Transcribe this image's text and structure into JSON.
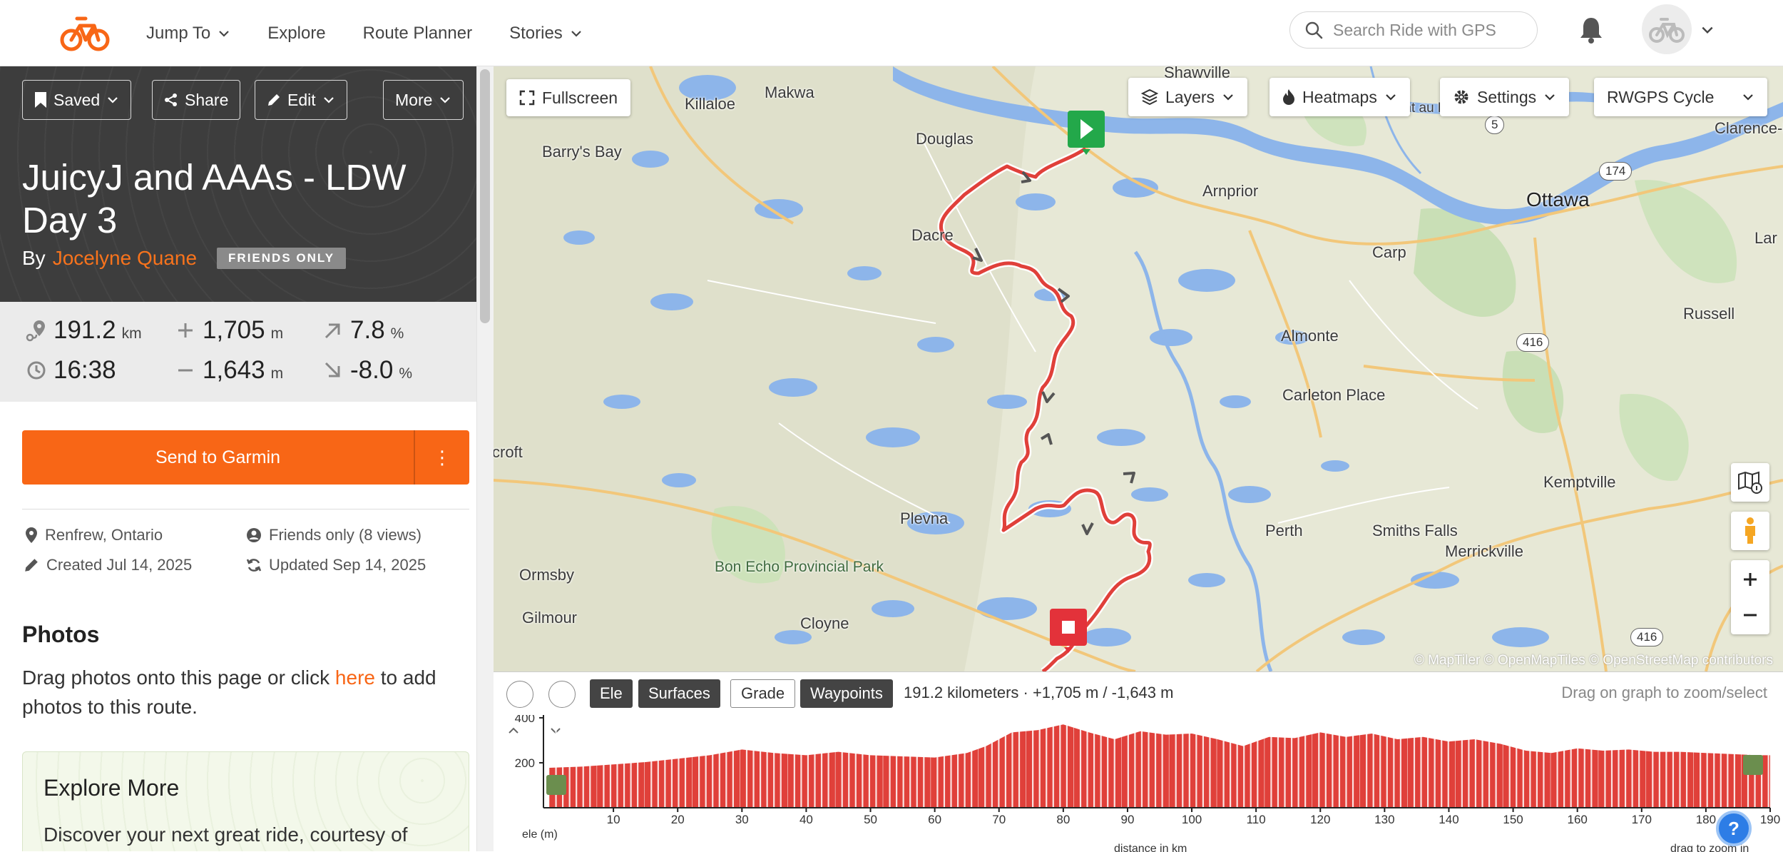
{
  "nav": {
    "items": [
      {
        "label": "Jump To",
        "has_dropdown": true
      },
      {
        "label": "Explore",
        "has_dropdown": false
      },
      {
        "label": "Route Planner",
        "has_dropdown": false
      },
      {
        "label": "Stories",
        "has_dropdown": true
      }
    ],
    "search_placeholder": "Search Ride with GPS",
    "icons": {
      "logo": "bike-logo",
      "search": "search-icon",
      "bell": "bell-icon",
      "avatar": "bike-avatar-icon"
    }
  },
  "route": {
    "buttons": {
      "saved": "Saved",
      "share": "Share",
      "edit": "Edit",
      "more": "More"
    },
    "title": "JuicyJ and AAAs - LDW Day 3",
    "by_prefix": "By",
    "author": "Jocelyne Quane",
    "visibility_badge": "FRIENDS ONLY",
    "stats": {
      "distance": {
        "value": "191.2",
        "unit": "km"
      },
      "elevation_gain": {
        "value": "1,705",
        "unit": "m"
      },
      "max_grade": {
        "value": "7.8",
        "unit": "%"
      },
      "duration": {
        "value": "16:38",
        "unit": ""
      },
      "elevation_loss": {
        "value": "1,643",
        "unit": "m"
      },
      "min_grade": {
        "value": "-8.0",
        "unit": "%"
      }
    },
    "send_button": "Send to Garmin",
    "send_more": "⋮",
    "meta": {
      "location": "Renfrew, Ontario",
      "views": "Friends only (8 views)",
      "created": "Created Jul 14, 2025",
      "updated": "Updated Sep 14, 2025"
    },
    "photos": {
      "heading": "Photos",
      "text_before": "Drag photos onto this page or click ",
      "link": "here",
      "text_after": " to add photos to this route."
    },
    "explore": {
      "heading": "Explore More",
      "text": "Discover your next great ride, courtesy of"
    }
  },
  "map": {
    "controls": {
      "fullscreen": "Fullscreen",
      "layers": "Layers",
      "heatmaps": "Heatmaps",
      "settings": "Settings",
      "style": "RWGPS Cycle"
    },
    "places": [
      {
        "name": "Shawville"
      },
      {
        "name": "Killaloe"
      },
      {
        "name": "Makwa"
      },
      {
        "name": "Barry's Bay"
      },
      {
        "name": "Douglas"
      },
      {
        "name": "Mont au McKinstry"
      },
      {
        "name": "Clarence-R"
      },
      {
        "name": "Ottawa"
      },
      {
        "name": "Arnprior"
      },
      {
        "name": "Dacre"
      },
      {
        "name": "Carp"
      },
      {
        "name": "Lar"
      },
      {
        "name": "Russell"
      },
      {
        "name": "Almonte"
      },
      {
        "name": "Carleton Place"
      },
      {
        "name": "croft"
      },
      {
        "name": "Plevna"
      },
      {
        "name": "Kemptville"
      },
      {
        "name": "Ormsby"
      },
      {
        "name": "Bon Echo Provincial Park"
      },
      {
        "name": "Perth"
      },
      {
        "name": "Smiths Falls"
      },
      {
        "name": "Merrickville"
      },
      {
        "name": "Gilmour"
      },
      {
        "name": "Cloyne"
      }
    ],
    "shields": [
      "5",
      "174",
      "416",
      "416"
    ],
    "attribution": "© MapTiler © OpenMapTiles © OpenStreetMap contributors"
  },
  "elevation": {
    "tabs": [
      {
        "label": "Ele",
        "active": true
      },
      {
        "label": "Surfaces",
        "active": true
      },
      {
        "label": "Grade",
        "active": false
      },
      {
        "label": "Waypoints",
        "active": true
      }
    ],
    "summary": "191.2 kilometers · +1,705 m / -1,643 m",
    "hint": "Drag on graph to zoom/select",
    "y_ticks": [
      "400",
      "200"
    ],
    "x_ticks": [
      "10",
      "20",
      "30",
      "40",
      "50",
      "60",
      "70",
      "80",
      "90",
      "100",
      "110",
      "120",
      "130",
      "140",
      "150",
      "160",
      "170",
      "180",
      "190"
    ],
    "y_label": "ele (m)",
    "x_label": "distance in km",
    "x_hint": "drag to zoom in"
  },
  "colors": {
    "brand": "#f86616",
    "route": "#e0403a",
    "start": "#23a84a",
    "end": "#e3323a"
  }
}
